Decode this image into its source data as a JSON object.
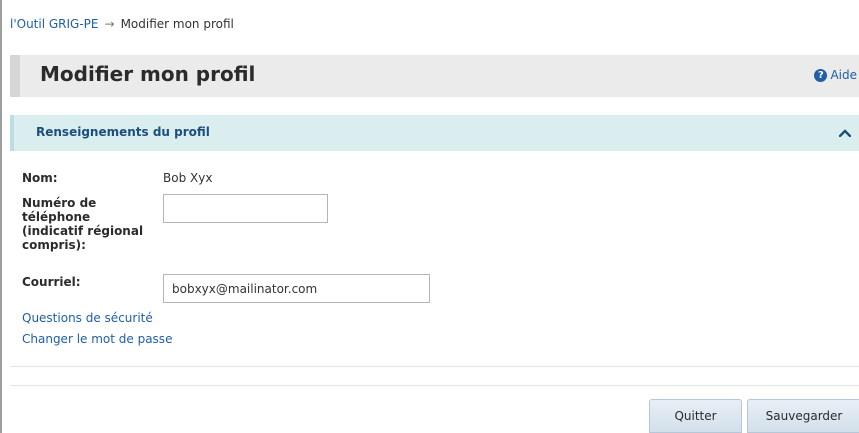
{
  "breadcrumb": {
    "root_label": "l'Outil GRIG-PE",
    "separator": "→",
    "current_label": "Modifier mon profil"
  },
  "header": {
    "title": "Modifier mon profil",
    "help_label": "Aide",
    "help_icon": "question-circle-icon"
  },
  "section": {
    "title": "Renseignements du profil",
    "collapse_icon": "chevron-up-icon"
  },
  "form": {
    "name_label": "Nom:",
    "name_value": "Bob Xyx",
    "phone_label": "Numéro de téléphone (indicatif régional compris):",
    "phone_value": "",
    "email_label": "Courriel:",
    "email_value": "bobxyx@mailinator.com"
  },
  "links": {
    "security_questions": "Questions de sécurité",
    "change_password": "Changer le mot de passe"
  },
  "buttons": {
    "quit": "Quitter",
    "save": "Sauvegarder"
  },
  "colors": {
    "link": "#1f5fa6",
    "section_bg": "#daeef0",
    "section_title": "#1d4f7d",
    "title_bar_bg": "#ebebeb"
  }
}
